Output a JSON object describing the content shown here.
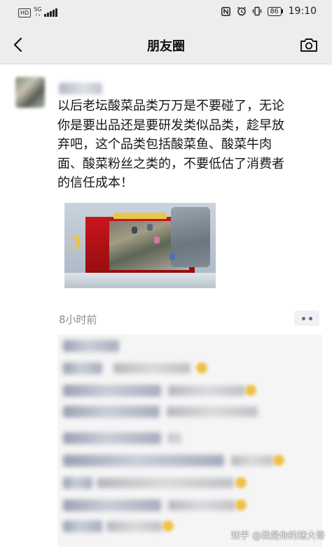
{
  "status_bar": {
    "hd_label": "HD",
    "network_label": "5G",
    "battery_level": "86",
    "time": "19:10",
    "icons": [
      "nfc-icon",
      "alarm-icon",
      "vibrate-icon",
      "battery-icon"
    ]
  },
  "nav": {
    "title": "朋友圈",
    "back_icon": "back-chevron-icon",
    "camera_icon": "camera-icon"
  },
  "post": {
    "text_lines": [
      "以后老坛酸菜品类万万是不要碰了，无论",
      "你是要出品还是要研发类似品类，趁早放",
      "弃吧，这个品类包括酸菜鱼、酸菜牛肉",
      "面、酸菜粉丝之类的，不要低估了消费者",
      "的信任成本！"
    ],
    "timestamp": "8小时前"
  },
  "colors": {
    "status_nav_bg": "#ededed",
    "link_blue": "#576b95",
    "comment_bg": "#f5f5f5"
  },
  "watermark": "知乎 @我是你的猪大哥"
}
